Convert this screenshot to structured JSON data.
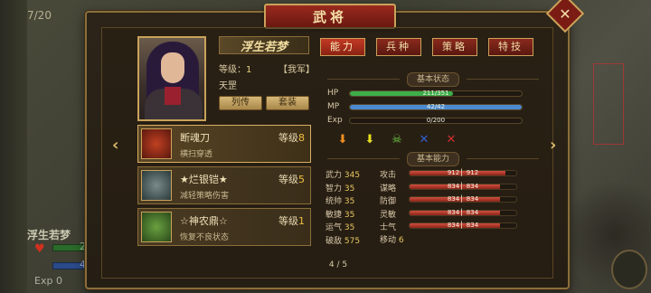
{
  "background": {
    "page_counter": "7/20",
    "hero_name": "浮生若梦",
    "hp_value": "211",
    "mp_value": "42",
    "exp_label": "Exp",
    "exp_value": "0"
  },
  "window": {
    "title": "武将",
    "close_symbol": "✕"
  },
  "hero": {
    "name": "浮生若梦",
    "level_label": "等级：",
    "level_value": "1",
    "faction": "【我军】",
    "star": "天罡",
    "btn_biography": "列传",
    "btn_set": "套装"
  },
  "equipment": [
    {
      "name": "断魂刀",
      "level_label": "等级",
      "level": "8",
      "desc": "横扫穿透",
      "icon": "blade-icon",
      "color": "#8a2a1a"
    },
    {
      "name": "★烂银铠★",
      "level_label": "等级",
      "level": "5",
      "desc": "减轻策略伤害",
      "icon": "armor-icon",
      "color": "#4a5a5a"
    },
    {
      "name": "☆神农鼎☆",
      "level_label": "等级",
      "level": "1",
      "desc": "恢复不良状态",
      "icon": "cauldron-icon",
      "color": "#3a6a2a"
    }
  ],
  "tabs": [
    {
      "label": "能力",
      "active": true
    },
    {
      "label": "兵种",
      "active": false
    },
    {
      "label": "策略",
      "active": false
    },
    {
      "label": "特技",
      "active": false
    }
  ],
  "basic_status": {
    "heading": "基本状态",
    "hp": {
      "label": "HP",
      "current": 211,
      "max": 351,
      "text": "211/351",
      "color": "#3cae4a"
    },
    "mp": {
      "label": "MP",
      "current": 42,
      "max": 42,
      "text": "42/42",
      "color": "#4a8ad0"
    },
    "exp": {
      "label": "Exp",
      "current": 0,
      "max": 200,
      "text": "0/200",
      "color": "#c8a030"
    }
  },
  "status_icons": [
    "arrow-down-orange-icon",
    "arrow-down-yellow-icon",
    "skull-icon",
    "crossed-sword-icon",
    "broken-sword-icon"
  ],
  "basic_ability": {
    "heading": "基本能力",
    "left": [
      {
        "name": "武力",
        "value": "345"
      },
      {
        "name": "智力",
        "value": "35"
      },
      {
        "name": "统帅",
        "value": "35"
      },
      {
        "name": "敏捷",
        "value": "35"
      },
      {
        "name": "运气",
        "value": "35"
      },
      {
        "name": "破敌",
        "value": "575"
      }
    ],
    "right": [
      {
        "name": "攻击",
        "text": "912 ▏912",
        "fill": 0.9
      },
      {
        "name": "谋略",
        "text": "834 ▏834",
        "fill": 0.85
      },
      {
        "name": "防御",
        "text": "834 ▏834",
        "fill": 0.85
      },
      {
        "name": "灵敏",
        "text": "834 ▏834",
        "fill": 0.85
      },
      {
        "name": "士气",
        "text": "834 ▏834",
        "fill": 0.85
      }
    ],
    "move_label": "移动",
    "move_value": "6"
  },
  "page_indicator": "4 / 5"
}
